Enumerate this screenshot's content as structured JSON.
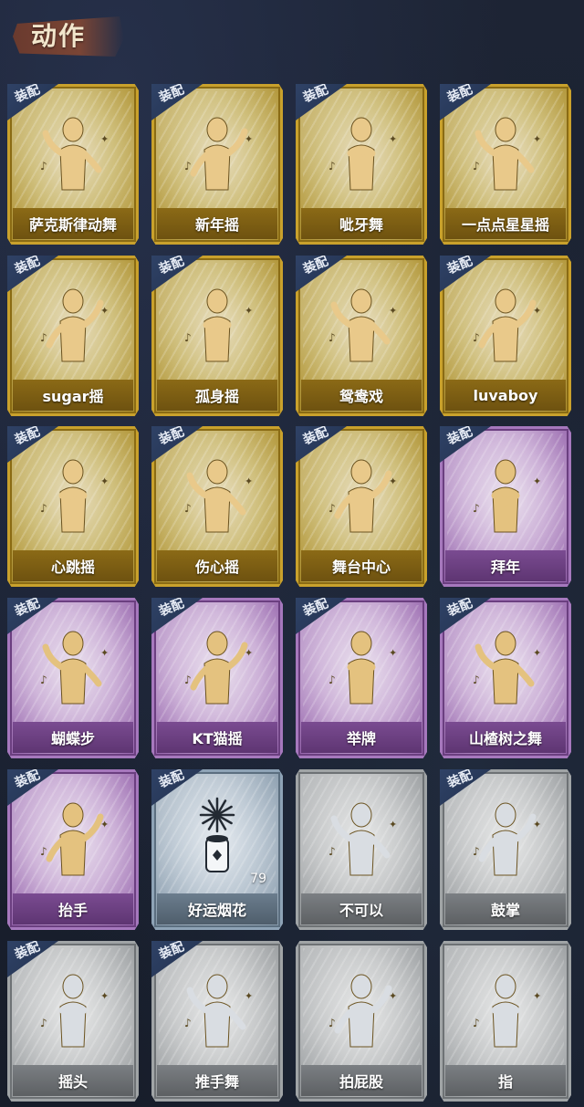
{
  "page": {
    "title": "动作"
  },
  "colors": {
    "gold": "#c9a12c",
    "purple": "#a678bd",
    "blue": "#8ea3b6",
    "gray": "#a0a4a6",
    "badge": "#2f4266"
  },
  "badge_label": "装配",
  "actions": [
    {
      "label": "萨克斯律动舞",
      "tier": "gold",
      "equipped": true,
      "icon": "saxophone-dancer-icon"
    },
    {
      "label": "新年摇",
      "tier": "gold",
      "equipped": true,
      "icon": "new-year-dancer-icon"
    },
    {
      "label": "呲牙舞",
      "tier": "gold",
      "equipped": true,
      "icon": "grin-dance-icon"
    },
    {
      "label": "一点点星星摇",
      "tier": "gold",
      "equipped": true,
      "icon": "star-shake-icon"
    },
    {
      "label": "sugar摇",
      "tier": "gold",
      "equipped": true,
      "icon": "sugar-dance-icon"
    },
    {
      "label": "孤身摇",
      "tier": "gold",
      "equipped": true,
      "icon": "solo-dance-icon"
    },
    {
      "label": "鸳鸯戏",
      "tier": "gold",
      "equipped": true,
      "icon": "duet-dance-icon"
    },
    {
      "label": "luvaboy",
      "tier": "gold",
      "equipped": true,
      "icon": "luvaboy-dance-icon"
    },
    {
      "label": "心跳摇",
      "tier": "gold",
      "equipped": true,
      "icon": "heartbeat-dance-icon"
    },
    {
      "label": "伤心摇",
      "tier": "gold",
      "equipped": true,
      "icon": "heart-hands-icon"
    },
    {
      "label": "舞台中心",
      "tier": "gold",
      "equipped": true,
      "icon": "center-stage-icon"
    },
    {
      "label": "拜年",
      "tier": "purple",
      "equipped": true,
      "icon": "greeting-bow-icon"
    },
    {
      "label": "蝴蝶步",
      "tier": "purple",
      "equipped": true,
      "icon": "butterfly-step-icon"
    },
    {
      "label": "KT猫摇",
      "tier": "purple",
      "equipped": true,
      "icon": "cat-dance-icon"
    },
    {
      "label": "举牌",
      "tier": "purple",
      "equipped": true,
      "icon": "hold-sign-icon"
    },
    {
      "label": "山楂树之舞",
      "tier": "purple",
      "equipped": true,
      "icon": "hawthorn-dance-icon"
    },
    {
      "label": "抬手",
      "tier": "purple",
      "equipped": true,
      "icon": "raise-hand-icon"
    },
    {
      "label": "好运烟花",
      "tier": "blue",
      "equipped": true,
      "icon": "firework-icon",
      "count": "79"
    },
    {
      "label": "不可以",
      "tier": "gray",
      "equipped": false,
      "icon": "finger-wag-icon"
    },
    {
      "label": "鼓掌",
      "tier": "gray",
      "equipped": true,
      "icon": "clap-icon"
    },
    {
      "label": "摇头",
      "tier": "gray",
      "equipped": true,
      "icon": "head-shake-icon"
    },
    {
      "label": "推手舞",
      "tier": "gray",
      "equipped": true,
      "icon": "push-hand-dance-icon"
    },
    {
      "label": "拍屁股",
      "tier": "gray",
      "equipped": false,
      "icon": "slap-butt-icon"
    },
    {
      "label": "指",
      "tier": "gray",
      "equipped": false,
      "icon": "pointing-hand-icon"
    }
  ]
}
